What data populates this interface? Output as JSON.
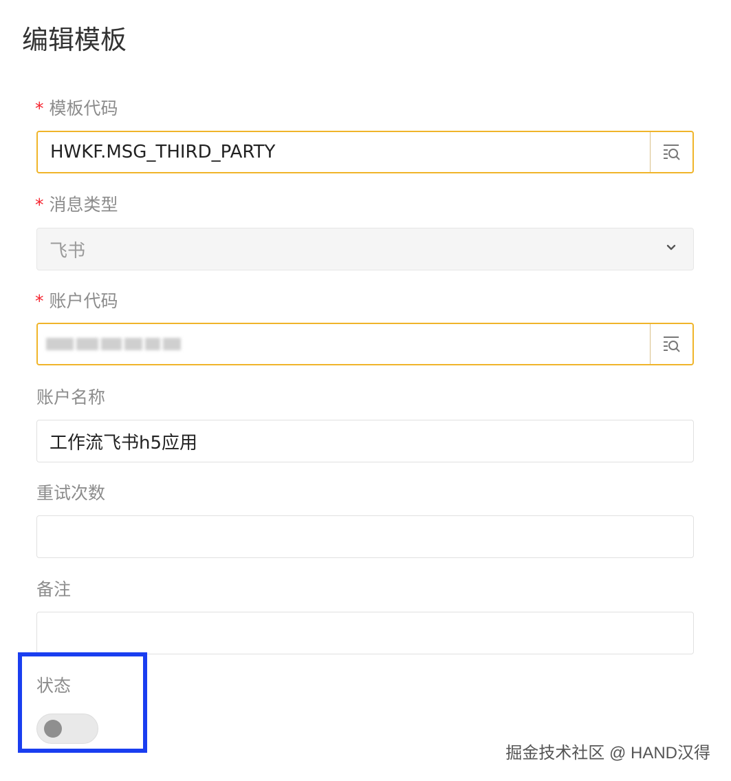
{
  "page": {
    "title": "编辑模板"
  },
  "form": {
    "template_code": {
      "label": "模板代码",
      "required_mark": "*",
      "value": "HWKF.MSG_THIRD_PARTY",
      "lov_icon": "lookup-search-icon"
    },
    "message_type": {
      "label": "消息类型",
      "required_mark": "*",
      "value": "飞书",
      "dropdown_icon": "chevron-down-icon"
    },
    "account_code": {
      "label": "账户代码",
      "required_mark": "*",
      "value_obscured": true,
      "lov_icon": "lookup-search-icon"
    },
    "account_name": {
      "label": "账户名称",
      "value": "工作流飞书h5应用"
    },
    "retry_count": {
      "label": "重试次数",
      "value": ""
    },
    "remark": {
      "label": "备注",
      "value": ""
    },
    "status": {
      "label": "状态",
      "enabled": false
    }
  },
  "colors": {
    "focus_border": "#f0b429",
    "required": "#f5222d",
    "highlight": "#1a3ef0"
  },
  "watermark": "掘金技术社区 @ HAND汉得"
}
